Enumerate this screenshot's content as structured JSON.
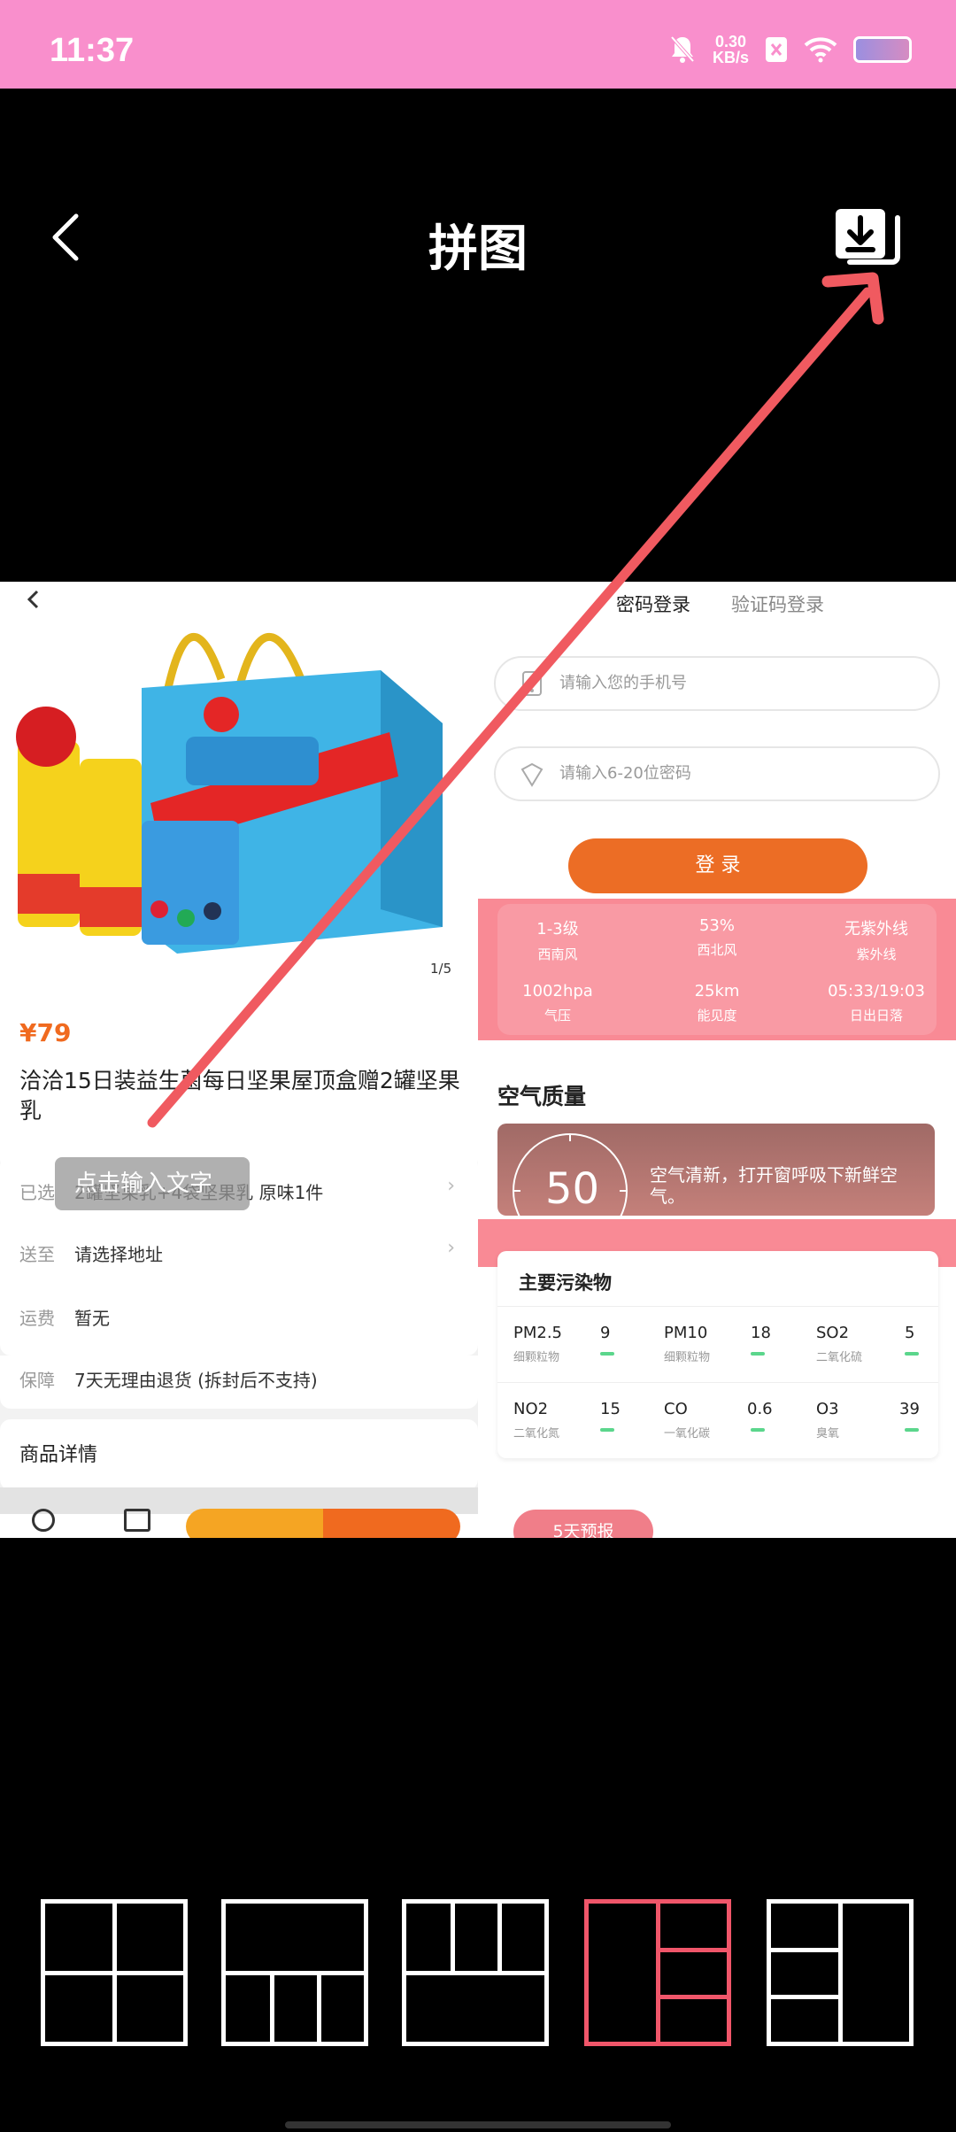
{
  "status_bar": {
    "time": "11:37",
    "net_speed_value": "0.30",
    "net_speed_unit": "KB/s"
  },
  "header": {
    "title": "拼图"
  },
  "left_panel": {
    "image_counter": "1/5",
    "price": "¥79",
    "product_title": "洽洽15日装益生菌每日坚果屋顶盒赠2罐坚果乳",
    "overlay_text": "点击输入文字",
    "rows": [
      {
        "key": "已选",
        "value": "2罐坚果乳+4袋坚果乳 原味1件"
      },
      {
        "key": "送至",
        "value": "请选择地址"
      },
      {
        "key": "运费",
        "value": "暂无"
      },
      {
        "key": "保障",
        "value": "7天无理由退货 (拆封后不支持)"
      }
    ],
    "details_title": "商品详情"
  },
  "right_panel": {
    "tabs": [
      "密码登录",
      "验证码登录"
    ],
    "phone_placeholder": "请输入您的手机号",
    "password_placeholder": "请输入6-20位密码",
    "login_label": "登 录",
    "weather": [
      {
        "value": "1-3级",
        "label": "西南风"
      },
      {
        "value": "53%",
        "label": "西北风"
      },
      {
        "value": "无紫外线",
        "label": "紫外线"
      },
      {
        "value": "1002hpa",
        "label": "气压"
      },
      {
        "value": "25km",
        "label": "能见度"
      },
      {
        "value": "05:33/19:03",
        "label": "日出日落"
      }
    ],
    "air_quality_title": "空气质量",
    "aqi_value": "50",
    "aqi_text": "空气清新，打开窗呼吸下新鲜空气。",
    "pollutants_title": "主要污染物",
    "pollutants": [
      {
        "name": "PM2.5",
        "sub": "细颗粒物",
        "value": "9"
      },
      {
        "name": "PM10",
        "sub": "细颗粒物",
        "value": "18"
      },
      {
        "name": "SO2",
        "sub": "二氧化硫",
        "value": "5"
      },
      {
        "name": "NO2",
        "sub": "二氧化氮",
        "value": "15"
      },
      {
        "name": "CO",
        "sub": "一氧化碳",
        "value": "0.6"
      },
      {
        "name": "O3",
        "sub": "臭氧",
        "value": "39"
      }
    ],
    "forecast_label": "5天预报"
  },
  "layout_options_selected_index": 3,
  "colors": {
    "status_bar": "#f98fcc",
    "accent": "#ec6d25",
    "selected_layout": "#f0566a",
    "arrow": "#f05a60"
  }
}
